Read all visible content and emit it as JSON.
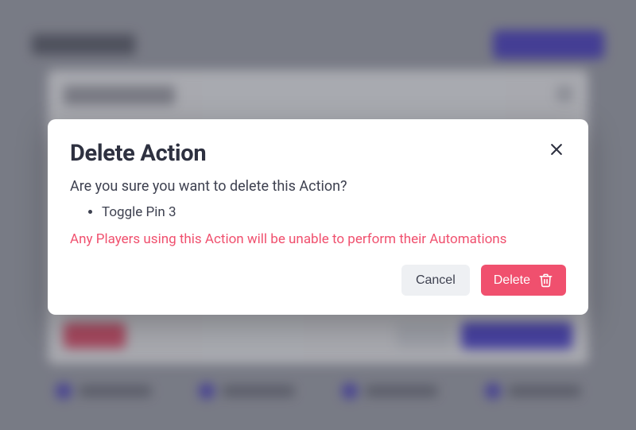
{
  "modal": {
    "title": "Delete Action",
    "question": "Are you sure you want to delete this Action?",
    "items": [
      "Toggle Pin 3"
    ],
    "warning": "Any Players using this Action will be unable to perform their Automations",
    "cancel_label": "Cancel",
    "delete_label": "Delete"
  },
  "colors": {
    "danger": "#f0506e",
    "text": "#3e4150",
    "heading": "#2e3140"
  }
}
